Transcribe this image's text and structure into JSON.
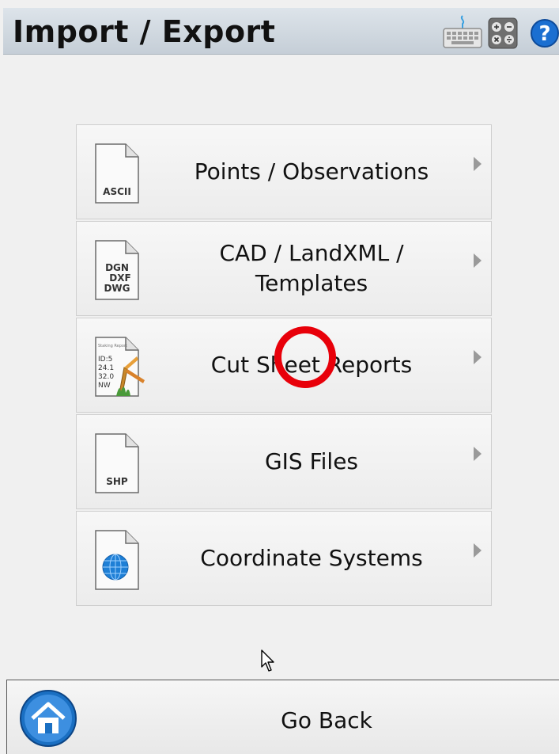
{
  "header": {
    "title": "Import / Export",
    "icons": [
      "keyboard-icon",
      "calculator-icon",
      "help-icon"
    ]
  },
  "menu": {
    "items": [
      {
        "label": "Points / Observations",
        "icon": "ascii-file-icon",
        "icon_text": "ASCII"
      },
      {
        "label": "CAD / LandXML / Templates",
        "line1": "CAD / LandXML /",
        "line2": "Templates",
        "icon": "cad-file-icon",
        "icon_text": [
          "DGN",
          "DXF",
          "DWG"
        ]
      },
      {
        "label": "Cut Sheet Reports",
        "icon": "cut-sheet-report-icon",
        "icon_text": [
          "Staking Report",
          "ID:5",
          "24.1",
          "32.0",
          "NW"
        ]
      },
      {
        "label": "GIS Files",
        "icon": "shp-file-icon",
        "icon_text": "SHP"
      },
      {
        "label": "Coordinate Systems",
        "icon": "globe-file-icon"
      }
    ]
  },
  "footer": {
    "go_back_label": "Go Back",
    "home_icon": "home-icon"
  },
  "colors": {
    "highlight_ring": "#e8000a",
    "globe_blue": "#1e7fd6",
    "help_blue": "#1b6fd1"
  }
}
